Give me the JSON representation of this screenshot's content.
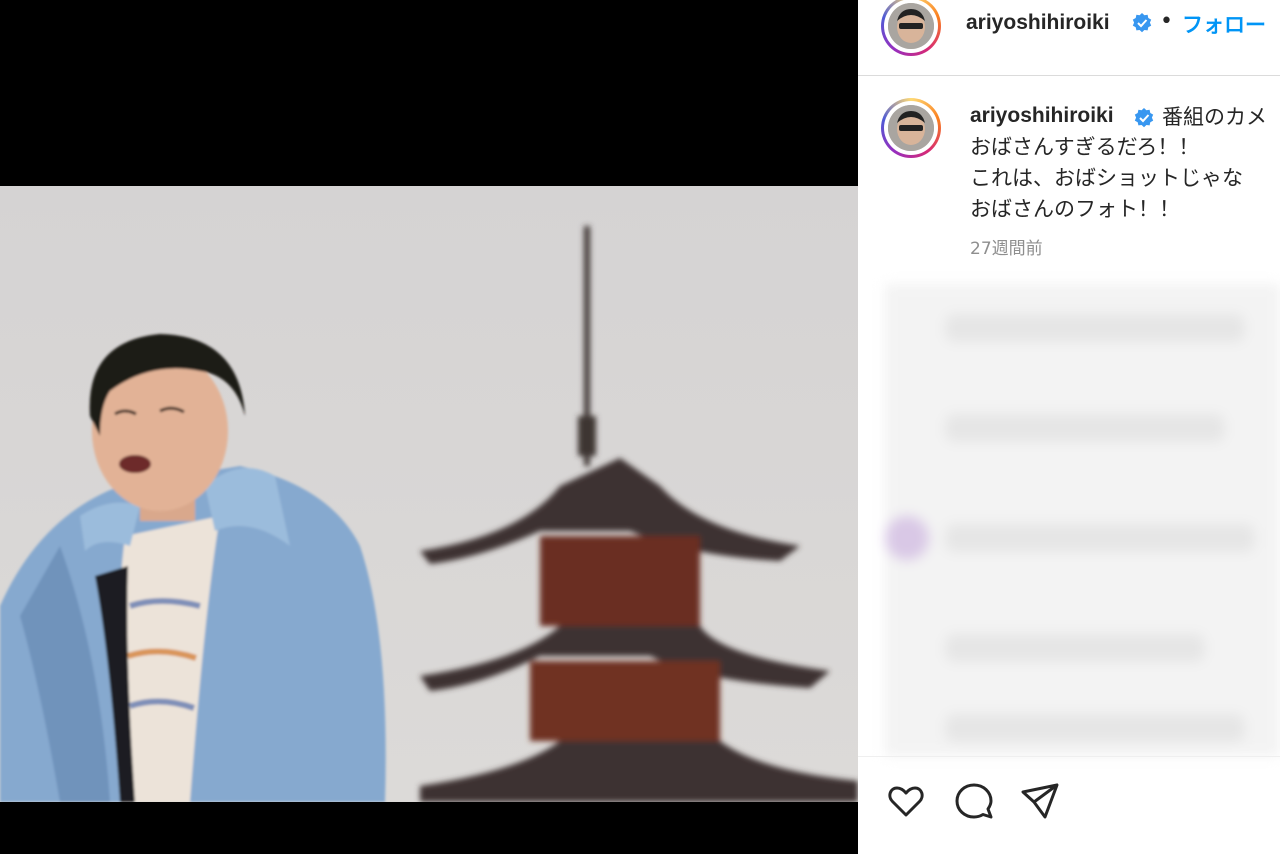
{
  "post": {
    "username": "ariyoshihiroiki",
    "separator": "•",
    "follow_label": "フォロー",
    "caption_first": "番組のカメ",
    "caption_lines": [
      "おばさんすぎるだろ！！",
      "これは、おばショットじゃな",
      "おばさんのフォト！！"
    ],
    "timestamp": "27週間前"
  },
  "icons": {
    "like": "heart-icon",
    "comment": "comment-icon",
    "share": "paper-plane-icon",
    "verified": "verified-badge-icon"
  },
  "colors": {
    "link": "#0095f6",
    "verified": "#3897f0",
    "text": "#262626",
    "muted": "#8e8e8e"
  }
}
